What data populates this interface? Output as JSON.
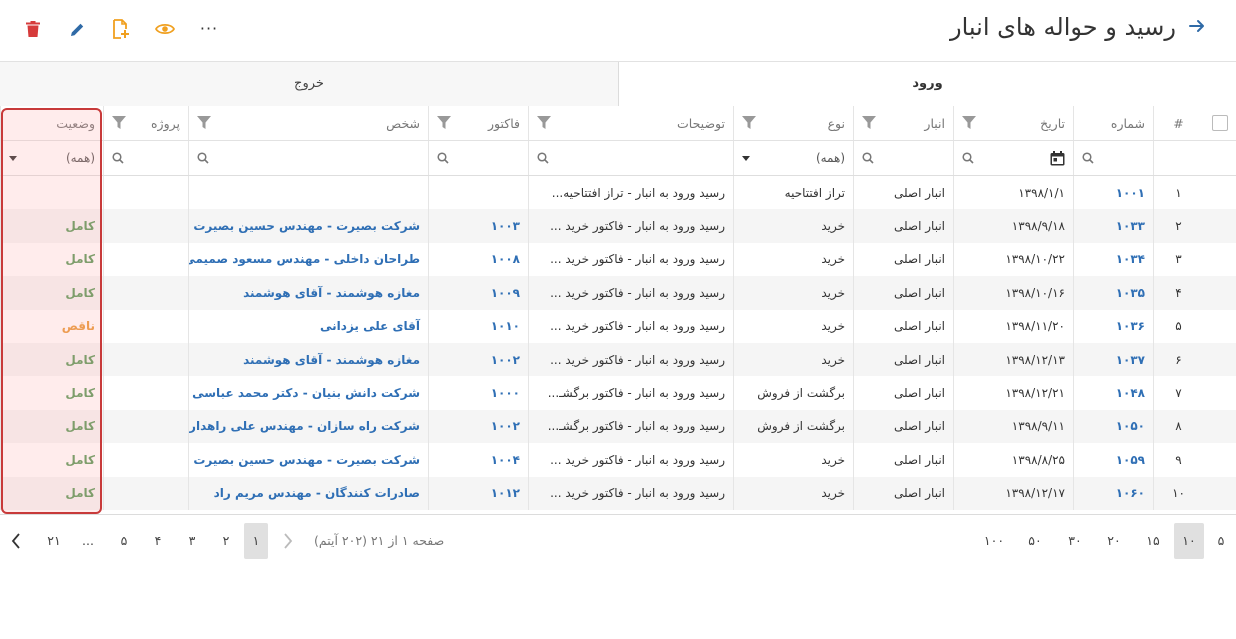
{
  "header": {
    "title": "رسید و حواله های انبار",
    "more_label": "···",
    "colors": {
      "delete": "#d63b3b",
      "edit": "#2f6aa6",
      "add": "#f0a020",
      "view": "#f0a020"
    }
  },
  "tabs": [
    {
      "label": "ورود",
      "active": true
    },
    {
      "label": "خروج",
      "active": false
    }
  ],
  "columns": {
    "row_num": "#",
    "number": "شماره",
    "date": "تاریخ",
    "warehouse": "انبار",
    "type": "نوع",
    "description": "توضیحات",
    "invoice": "فاکتور",
    "person": "شخص",
    "project": "پروژه",
    "status": "وضعیت"
  },
  "filters": {
    "type_value": "(همه)",
    "status_value": "(همه)"
  },
  "rows": [
    {
      "idx": "۱",
      "number": "۱۰۰۱",
      "date": "۱۳۹۸/۱/۱",
      "warehouse": "انبار اصلی",
      "type": "تراز افتتاحیه",
      "description": "رسید ورود به انبار - تراز افتتاحیه...",
      "invoice": "",
      "person": "",
      "project": "",
      "status": ""
    },
    {
      "idx": "۲",
      "number": "۱۰۳۳",
      "date": "۱۳۹۸/۹/۱۸",
      "warehouse": "انبار اصلی",
      "type": "خرید",
      "description": "رسید ورود به انبار - فاکتور خرید ...",
      "invoice": "۱۰۰۳",
      "person": "شرکت بصیرت - مهندس حسین بصیرت",
      "project": "",
      "status": "کامل"
    },
    {
      "idx": "۳",
      "number": "۱۰۳۴",
      "date": "۱۳۹۸/۱۰/۲۲",
      "warehouse": "انبار اصلی",
      "type": "خرید",
      "description": "رسید ورود به انبار - فاکتور خرید ...",
      "invoice": "۱۰۰۸",
      "person": "طراحان داخلی - مهندس مسعود صمیمی",
      "project": "",
      "status": "کامل"
    },
    {
      "idx": "۴",
      "number": "۱۰۳۵",
      "date": "۱۳۹۸/۱۰/۱۶",
      "warehouse": "انبار اصلی",
      "type": "خرید",
      "description": "رسید ورود به انبار - فاکتور خرید ...",
      "invoice": "۱۰۰۹",
      "person": "مغازه هوشمند - آقای هوشمند",
      "project": "",
      "status": "کامل"
    },
    {
      "idx": "۵",
      "number": "۱۰۳۶",
      "date": "۱۳۹۸/۱۱/۲۰",
      "warehouse": "انبار اصلی",
      "type": "خرید",
      "description": "رسید ورود به انبار - فاکتور خرید ...",
      "invoice": "۱۰۱۰",
      "person": "آقای علی یزدانی",
      "project": "",
      "status": "ناقص"
    },
    {
      "idx": "۶",
      "number": "۱۰۳۷",
      "date": "۱۳۹۸/۱۲/۱۳",
      "warehouse": "انبار اصلی",
      "type": "خرید",
      "description": "رسید ورود به انبار - فاکتور خرید ...",
      "invoice": "۱۰۰۲",
      "person": "مغازه هوشمند - آقای هوشمند",
      "project": "",
      "status": "کامل"
    },
    {
      "idx": "۷",
      "number": "۱۰۴۸",
      "date": "۱۳۹۸/۱۲/۲۱",
      "warehouse": "انبار اصلی",
      "type": "برگشت از فروش",
      "description": "رسید ورود به انبار - فاکتور برگشـ...",
      "invoice": "۱۰۰۰",
      "person": "شرکت دانش بنیان - دکتر محمد عباسی",
      "project": "",
      "status": "کامل"
    },
    {
      "idx": "۸",
      "number": "۱۰۵۰",
      "date": "۱۳۹۸/۹/۱۱",
      "warehouse": "انبار اصلی",
      "type": "برگشت از فروش",
      "description": "رسید ورود به انبار - فاکتور برگشـ...",
      "invoice": "۱۰۰۲",
      "person": "شرکت راه سازان - مهندس علی راهداری",
      "project": "",
      "status": "کامل"
    },
    {
      "idx": "۹",
      "number": "۱۰۵۹",
      "date": "۱۳۹۸/۸/۲۵",
      "warehouse": "انبار اصلی",
      "type": "خرید",
      "description": "رسید ورود به انبار - فاکتور خرید ...",
      "invoice": "۱۰۰۴",
      "person": "شرکت بصیرت - مهندس حسین بصیرت",
      "project": "",
      "status": "کامل"
    },
    {
      "idx": "۱۰",
      "number": "۱۰۶۰",
      "date": "۱۳۹۸/۱۲/۱۷",
      "warehouse": "انبار اصلی",
      "type": "خرید",
      "description": "رسید ورود به انبار - فاکتور خرید ...",
      "invoice": "۱۰۱۲",
      "person": "صادرات کنندگان - مهندس مریم راد",
      "project": "",
      "status": "کامل"
    }
  ],
  "pager": {
    "page_sizes": [
      "۵",
      "۱۰",
      "۱۵",
      "۲۰",
      "۳۰",
      "۵۰",
      "۱۰۰"
    ],
    "active_page_size": "۱۰",
    "info": "صفحه ۱ از ۲۱ (۲۰۲ آیتم)",
    "pages": [
      "۱",
      "۲",
      "۳",
      "۴",
      "۵",
      "...",
      "۲۱"
    ],
    "current_page": "۱"
  }
}
